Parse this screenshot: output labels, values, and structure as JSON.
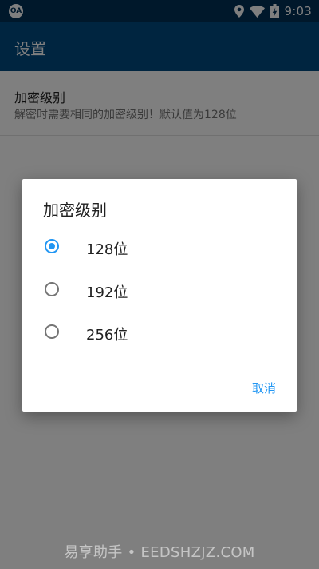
{
  "status_bar": {
    "time": "9:03",
    "app_icon_label": "OA",
    "icons": [
      "location-icon",
      "wifi-icon",
      "battery-charging-icon"
    ]
  },
  "app_bar": {
    "title": "设置"
  },
  "preference": {
    "title": "加密级别",
    "summary": "解密时需要相同的加密级别！默认值为128位"
  },
  "dialog": {
    "title": "加密级别",
    "options": [
      {
        "label": "128位",
        "selected": true
      },
      {
        "label": "192位",
        "selected": false
      },
      {
        "label": "256位",
        "selected": false
      }
    ],
    "cancel_label": "取消"
  },
  "watermark": "易享助手 • EEDSHZJZ.COM",
  "colors": {
    "status_bar": "#013057",
    "app_bar": "#014a80",
    "accent": "#2196f3"
  }
}
